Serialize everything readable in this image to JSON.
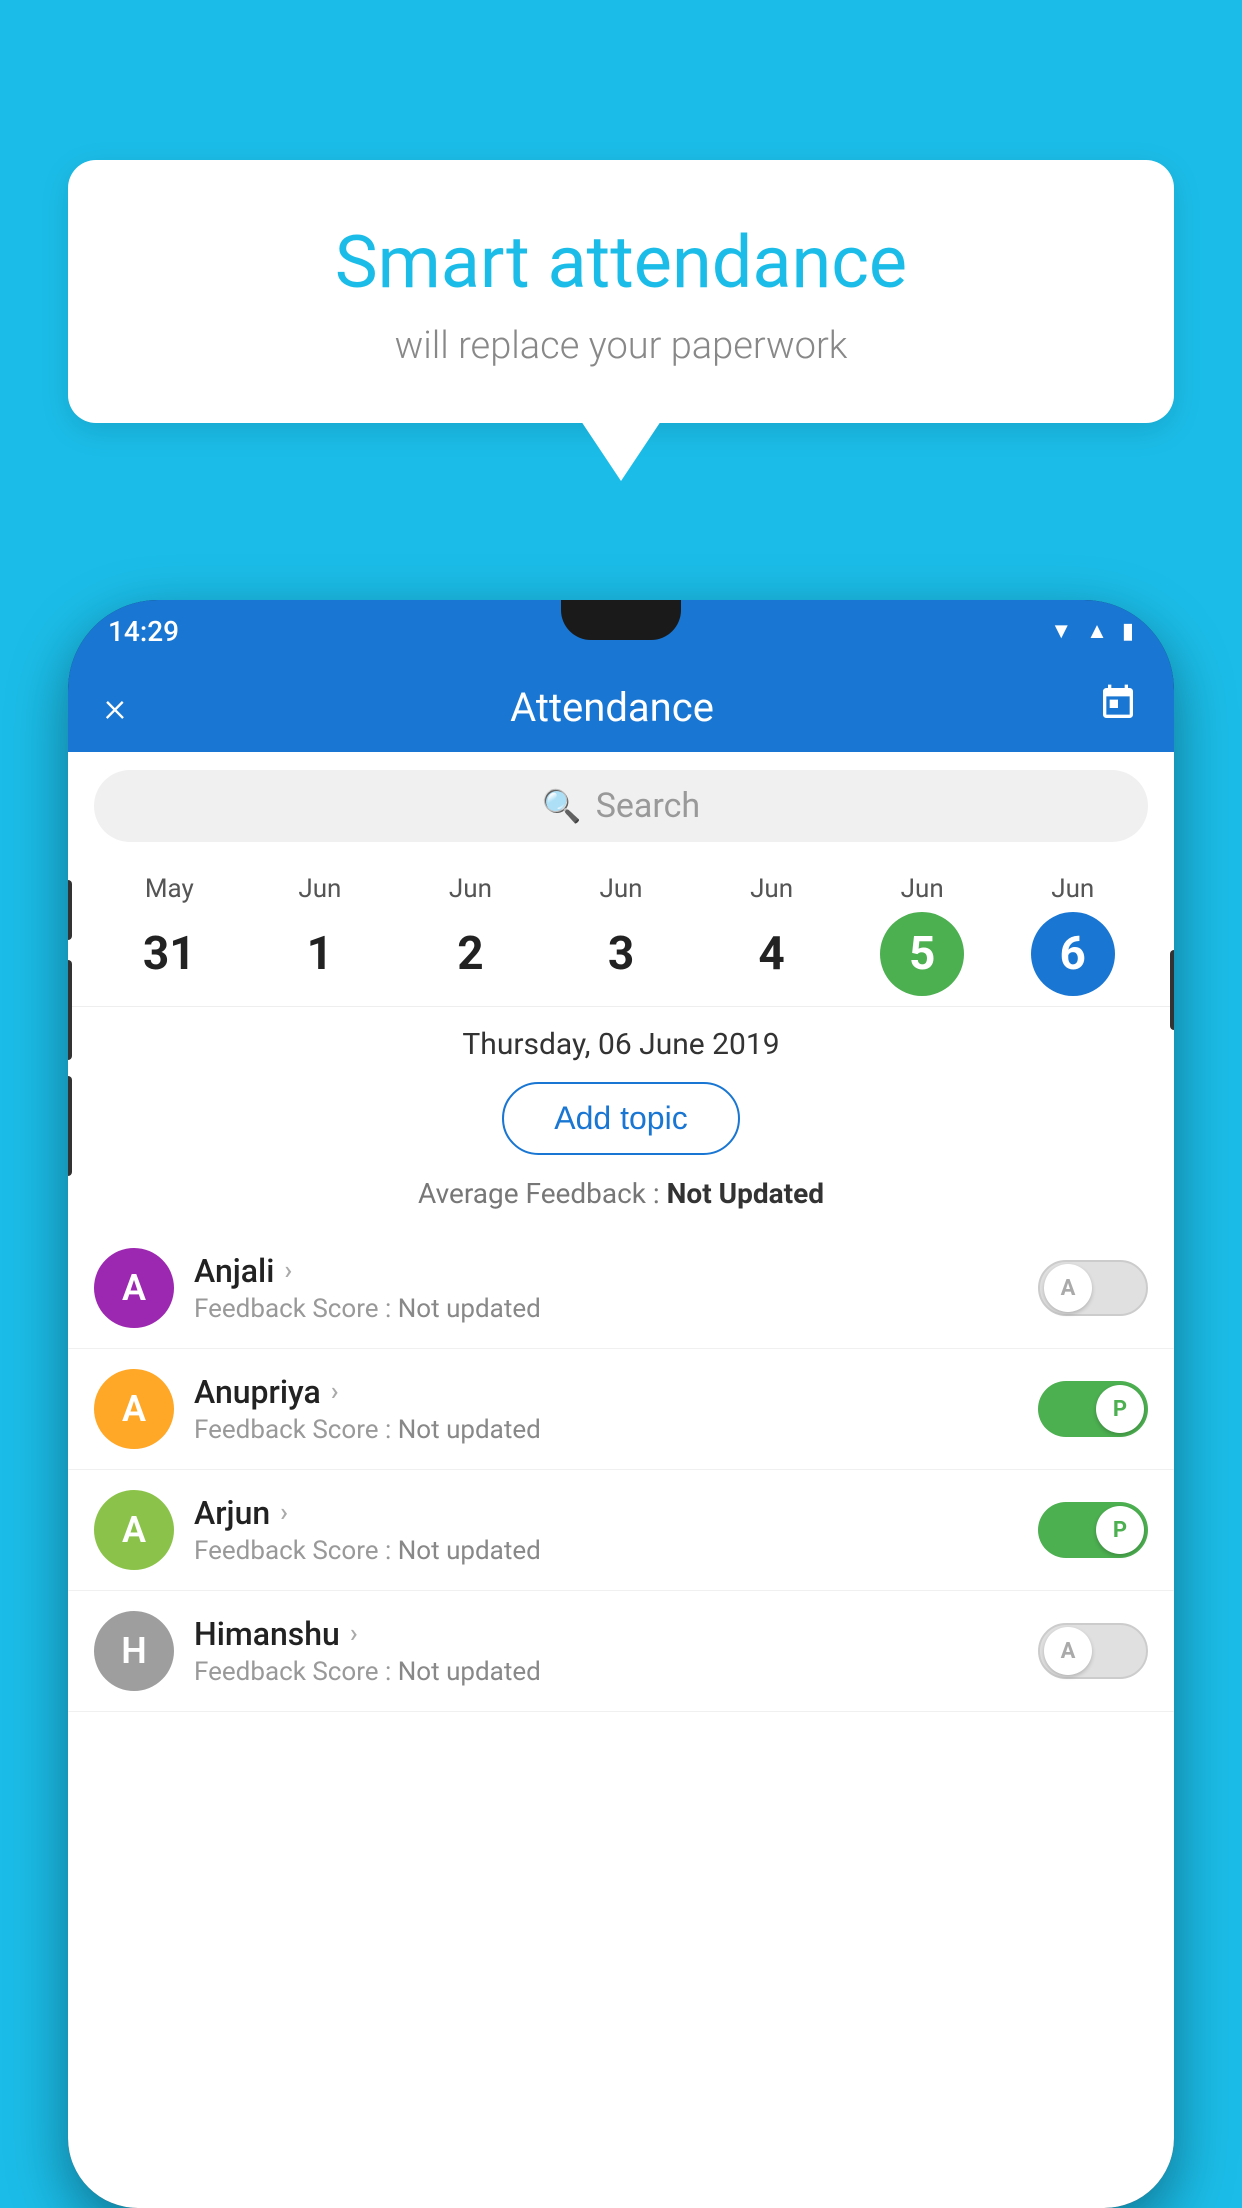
{
  "background_color": "#1BBDE8",
  "speech_bubble": {
    "title": "Smart attendance",
    "subtitle": "will replace your paperwork"
  },
  "status_bar": {
    "time": "14:29",
    "icons": [
      "wifi",
      "signal",
      "battery"
    ]
  },
  "app_header": {
    "title": "Attendance",
    "close_label": "×",
    "calendar_icon": "📅"
  },
  "search": {
    "placeholder": "Search"
  },
  "calendar": {
    "days": [
      {
        "month": "May",
        "date": "31",
        "style": "normal"
      },
      {
        "month": "Jun",
        "date": "1",
        "style": "normal"
      },
      {
        "month": "Jun",
        "date": "2",
        "style": "normal"
      },
      {
        "month": "Jun",
        "date": "3",
        "style": "normal"
      },
      {
        "month": "Jun",
        "date": "4",
        "style": "normal"
      },
      {
        "month": "Jun",
        "date": "5",
        "style": "today"
      },
      {
        "month": "Jun",
        "date": "6",
        "style": "selected"
      }
    ]
  },
  "selected_date": "Thursday, 06 June 2019",
  "add_topic_label": "Add topic",
  "average_feedback": {
    "label": "Average Feedback :",
    "value": "Not Updated"
  },
  "students": [
    {
      "name": "Anjali",
      "avatar_letter": "A",
      "avatar_color": "#9C27B0",
      "score_label": "Feedback Score :",
      "score_value": "Not updated",
      "toggle": "off",
      "toggle_letter": "A"
    },
    {
      "name": "Anupriya",
      "avatar_letter": "A",
      "avatar_color": "#FFA726",
      "score_label": "Feedback Score :",
      "score_value": "Not updated",
      "toggle": "on",
      "toggle_letter": "P"
    },
    {
      "name": "Arjun",
      "avatar_letter": "A",
      "avatar_color": "#8BC34A",
      "score_label": "Feedback Score :",
      "score_value": "Not updated",
      "toggle": "on",
      "toggle_letter": "P"
    },
    {
      "name": "Himanshu",
      "avatar_letter": "H",
      "avatar_color": "#9E9E9E",
      "score_label": "Feedback Score :",
      "score_value": "Not updated",
      "toggle": "off",
      "toggle_letter": "A"
    }
  ]
}
